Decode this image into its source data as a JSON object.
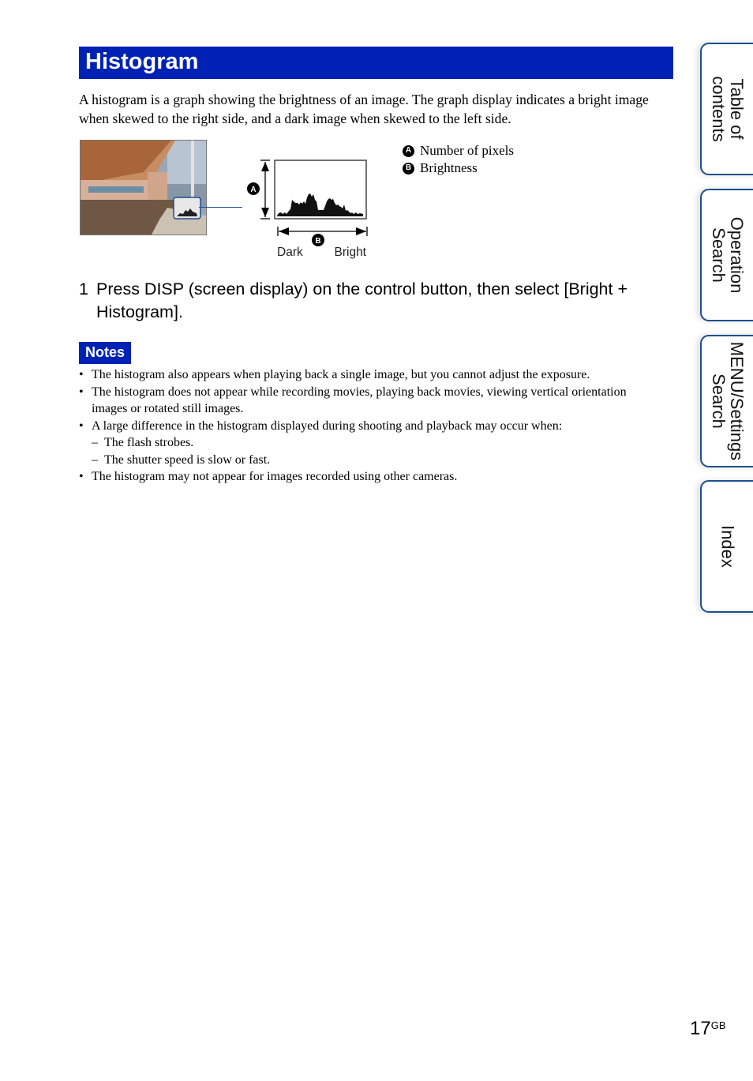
{
  "header": {
    "title": "Histogram"
  },
  "intro": "A histogram is a graph showing the brightness of an image. The graph display indicates a bright image when skewed to the right side, and a dark image when skewed to the left side.",
  "illustration": {
    "axis_a_badge": "A",
    "axis_b_badge": "B",
    "dark_label": "Dark",
    "bright_label": "Bright"
  },
  "legend": [
    {
      "badge": "A",
      "label": "Number of pixels"
    },
    {
      "badge": "B",
      "label": "Brightness"
    }
  ],
  "step": {
    "number": "1",
    "text": "Press DISP (screen display) on the control button, then select [Bright + Histogram]."
  },
  "notes": {
    "title": "Notes",
    "items": [
      "The histogram also appears when playing back a single image, but you cannot adjust the exposure.",
      "The histogram does not appear while recording movies, playing back movies, viewing vertical orientation images or rotated still images.",
      "A large difference in the histogram displayed during shooting and playback may occur when:",
      "The histogram may not appear for images recorded using other cameras."
    ],
    "subitems": [
      "The flash strobes.",
      "The shutter speed is slow or fast."
    ]
  },
  "side_tabs": [
    {
      "label": "Table of\ncontents"
    },
    {
      "label": "Operation\nSearch"
    },
    {
      "label": "MENU/Settings\nSearch"
    },
    {
      "label": "Index"
    }
  ],
  "footer": {
    "page": "17",
    "suffix": "GB"
  },
  "colors": {
    "accent": "#0022b4",
    "tab_border": "#1d4f8f"
  }
}
